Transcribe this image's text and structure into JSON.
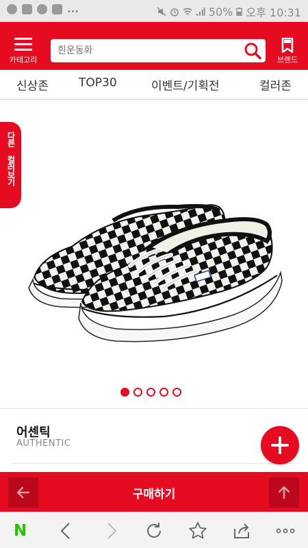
{
  "status_bar": {
    "battery": "50%",
    "time": "오후 10:31"
  },
  "header": {
    "category_label": "카테고리",
    "search_placeholder": "흰운동화",
    "brand_label": "브랜드"
  },
  "nav": {
    "tabs": [
      "신상존",
      "TOP30",
      "이벤트/기획전",
      "컬러존"
    ]
  },
  "side_tab": {
    "label": "다른 컬러보기"
  },
  "gallery": {
    "slide_count": 5,
    "active_index": 0
  },
  "product": {
    "name": "어센틱",
    "subtitle": "AUTHENTIC"
  },
  "buy_bar": {
    "label": "구매하기"
  },
  "icons": {
    "category": "hamburger-icon",
    "search": "search-icon",
    "brand": "bookmark-icon",
    "fab": "plus-icon",
    "prev": "arrow-left-icon",
    "top": "arrow-up-icon"
  },
  "colors": {
    "brand_red": "#e50c22",
    "naver_green": "#1ec800"
  }
}
